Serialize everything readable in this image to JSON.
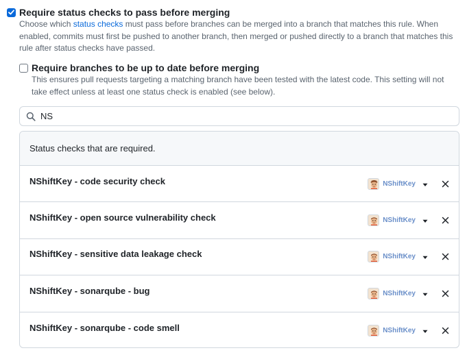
{
  "option1": {
    "checked": true,
    "title": "Require status checks to pass before merging",
    "desc_before": "Choose which ",
    "desc_link": "status checks",
    "desc_after": " must pass before branches can be merged into a branch that matches this rule. When enabled, commits must first be pushed to another branch, then merged or pushed directly to a branch that matches this rule after status checks have passed."
  },
  "option2": {
    "checked": false,
    "title": "Require branches to be up to date before merging",
    "desc": "This ensures pull requests targeting a matching branch have been tested with the latest code. This setting will not take effect unless at least one status check is enabled (see below)."
  },
  "search": {
    "value": "NS",
    "icon": "search-icon"
  },
  "checks_box": {
    "header": "Status checks that are required.",
    "items": [
      {
        "name": "NShiftKey - code security check",
        "app": "NShiftKey"
      },
      {
        "name": "NShiftKey - open source vulnerability check",
        "app": "NShiftKey"
      },
      {
        "name": "NShiftKey - sensitive data leakage check",
        "app": "NShiftKey"
      },
      {
        "name": "NShiftKey - sonarqube - bug",
        "app": "NShiftKey"
      },
      {
        "name": "NShiftKey - sonarqube - code smell",
        "app": "NShiftKey"
      }
    ]
  },
  "colors": {
    "accent": "#0969da",
    "app_name": "#6a8fc9",
    "border": "#d0d7de",
    "header_bg": "#f6f8fa"
  }
}
